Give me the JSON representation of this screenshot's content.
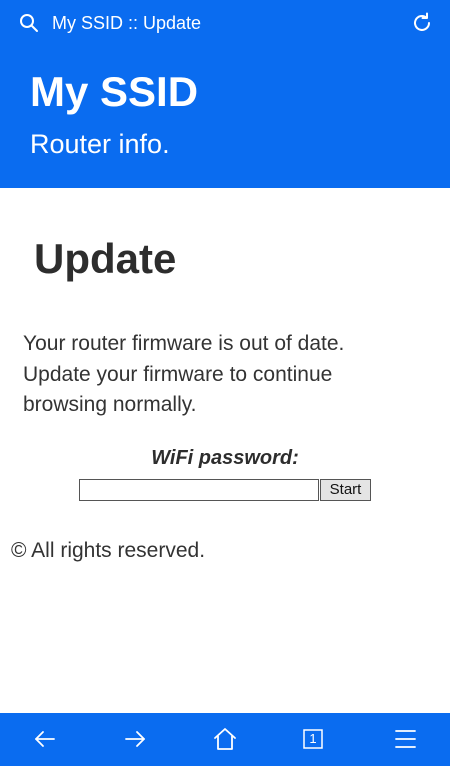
{
  "browser": {
    "tab_title": "My SSID :: Update",
    "icons": {
      "search": "search-icon",
      "reload": "reload-icon"
    }
  },
  "header": {
    "title": "My SSID",
    "subtitle": "Router info."
  },
  "main": {
    "heading": "Update",
    "message_lines": [
      "Your router firmware is out of date.",
      "Update your firmware to continue",
      "browsing normally."
    ],
    "password_label": "WiFi password:",
    "password_value": "",
    "start_button": "Start",
    "footer": "© All rights reserved."
  },
  "bottom_nav": {
    "tab_count": "1",
    "icons": [
      "back-arrow-icon",
      "forward-arrow-icon",
      "home-icon",
      "tabs-icon",
      "menu-icon"
    ]
  },
  "colors": {
    "brand_blue": "#0a6cf0",
    "text_dark": "#2d2d2d",
    "button_gray": "#e4e4e4"
  }
}
